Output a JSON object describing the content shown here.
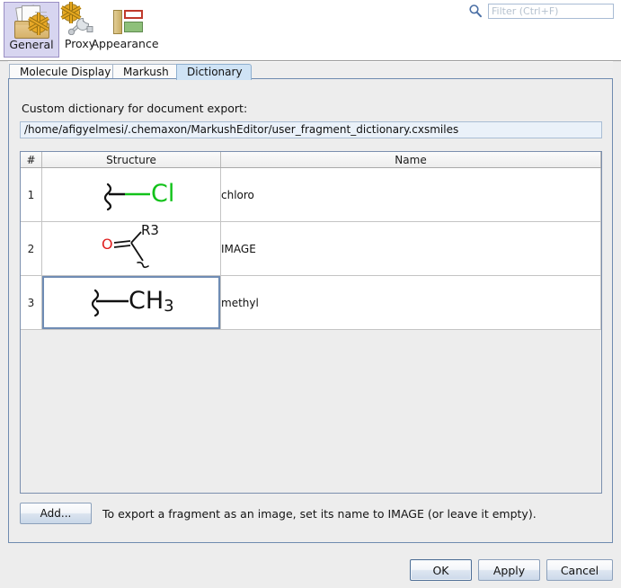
{
  "toolbar": {
    "items": [
      {
        "label": "General",
        "icon": "general-settings-icon",
        "selected": true
      },
      {
        "label": "Proxy",
        "icon": "proxy-gear-wrench-icon",
        "selected": false
      },
      {
        "label": "Appearance",
        "icon": "appearance-layout-icon",
        "selected": false
      }
    ],
    "search_icon": "search-icon",
    "filter_placeholder": "Filter (Ctrl+F)",
    "filter_value": ""
  },
  "tabs": [
    {
      "label": "Molecule Display",
      "selected": false
    },
    {
      "label": "Markush",
      "selected": false
    },
    {
      "label": "Dictionary",
      "selected": true
    }
  ],
  "panel": {
    "dictionary_label": "Custom dictionary for document export:",
    "dictionary_path": "/home/afigyelmesi/.chemaxon/MarkushEditor/user_fragment_dictionary.cxsmiles",
    "table": {
      "headers": [
        "#",
        "Structure",
        "Name"
      ],
      "rows": [
        {
          "num": "1",
          "structure": "chloro-fragment-attachment",
          "name": "chloro",
          "selected": false
        },
        {
          "num": "2",
          "structure": "carbonyl-r3-fragment",
          "name": "IMAGE",
          "selected": false
        },
        {
          "num": "3",
          "structure": "methyl-fragment-attachment",
          "name": "methyl",
          "selected": true
        }
      ]
    },
    "structure_atoms": {
      "cl": "Cl",
      "ch3_main": "CH",
      "ch3_sub": "3",
      "o": "O",
      "r3": "R3"
    },
    "add_button": "Add...",
    "add_hint": "To export a fragment as an image, set its name to IMAGE (or leave it empty)."
  },
  "dialog_buttons": {
    "ok": "OK",
    "apply": "Apply",
    "cancel": "Cancel"
  },
  "colors": {
    "selected_tab_bg": "#cfe3f5",
    "panel_border": "#6f8bb0",
    "chlorine_green": "#12c21a",
    "oxygen_red": "#e02020",
    "selection_blue": "#6f8cb4"
  }
}
